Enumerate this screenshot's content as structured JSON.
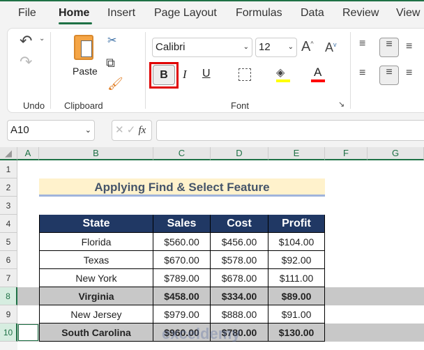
{
  "ribbon_tabs": [
    "File",
    "Home",
    "Insert",
    "Page Layout",
    "Formulas",
    "Data",
    "Review",
    "View"
  ],
  "active_tab": "Home",
  "groups": {
    "undo": "Undo",
    "clipboard": "Clipboard",
    "font": "Font"
  },
  "paste_label": "Paste",
  "font_name": "Calibri",
  "font_size": "12",
  "bold": "B",
  "italic": "I",
  "underline": "U",
  "font_color_glyph": "A",
  "colors": {
    "accent": "#1e7145",
    "header_fill": "#203864",
    "title_fill": "#fff2cc",
    "highlight": "#ffff00",
    "font_color": "#ff0000",
    "highlight_box": "#e00000"
  },
  "name_box": "A10",
  "fx": "fx",
  "columns": [
    "A",
    "B",
    "C",
    "D",
    "E",
    "F",
    "G"
  ],
  "rows": [
    "1",
    "2",
    "3",
    "4",
    "5",
    "6",
    "7",
    "8",
    "9",
    "10"
  ],
  "sheet_title": "Applying Find & Select Feature",
  "table": {
    "headers": [
      "State",
      "Sales",
      "Cost",
      "Profit"
    ],
    "rows": [
      [
        "Florida",
        "$560.00",
        "$456.00",
        "$104.00"
      ],
      [
        "Texas",
        "$670.00",
        "$578.00",
        "$92.00"
      ],
      [
        "New York",
        "$789.00",
        "$678.00",
        "$111.00"
      ],
      [
        "Virginia",
        "$458.00",
        "$334.00",
        "$89.00"
      ],
      [
        "New Jersey",
        "$979.00",
        "$888.00",
        "$91.00"
      ],
      [
        "South Carolina",
        "$960.00",
        "$780.00",
        "$130.00"
      ]
    ]
  },
  "watermark": "exceldemy"
}
